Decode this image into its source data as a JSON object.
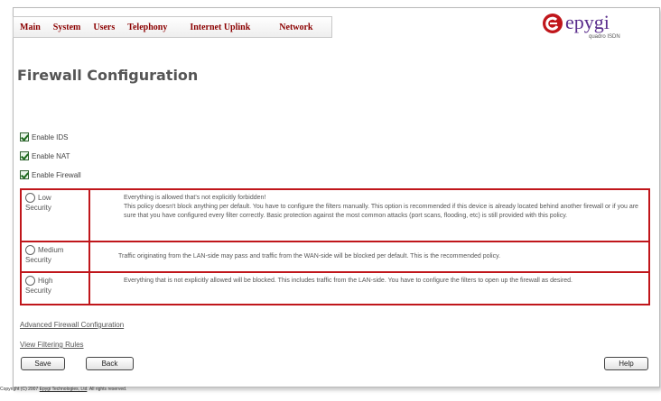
{
  "menu": {
    "items": [
      "Main",
      "System",
      "Users",
      "Telephony",
      "Internet Uplink",
      "Network"
    ]
  },
  "logo": {
    "brand": "epygi",
    "subtitle": "quadro ISDN",
    "colors": {
      "mark": "#c0161b",
      "brand": "#5a2d8c"
    }
  },
  "page": {
    "title": "Firewall Configuration"
  },
  "options": {
    "ids": {
      "label": "Enable IDS",
      "checked": true
    },
    "nat": {
      "label": "Enable NAT",
      "checked": true
    },
    "firewall": {
      "label": "Enable Firewall",
      "checked": true
    }
  },
  "security": {
    "low": {
      "label_line1": "Low",
      "label_line2": "Security",
      "desc_line1": "Everything is allowed that's not explicitly forbidden!",
      "desc_rest": "This policy doesn't block anything per default. You have to configure the filters manually. This option is recommended if this device is already located behind another firewall or if you are sure that you have configured every filter correctly. Basic protection against the most common attacks (port scans, flooding, etc) is still provided with this policy."
    },
    "medium": {
      "label_line1": "Medium",
      "label_line2": "Security",
      "desc": "Traffic originating from the LAN-side may pass and traffic from the WAN-side will be blocked per default. This is the recommended policy."
    },
    "high": {
      "label_line1": "High",
      "label_line2": "Security",
      "desc": "Everything that is not explicitly allowed will be blocked. This includes traffic from the LAN-side. You have to configure the filters to open up the firewall as desired."
    },
    "border_color": "#c0161b"
  },
  "links": {
    "advanced": "Advanced Firewall Configuration",
    "rules": "View Filtering Rules"
  },
  "buttons": {
    "save": "Save",
    "back": "Back",
    "help": "Help"
  },
  "footer": {
    "prefix": "Copyright (C) 2007",
    "company": "Epygi Technologies, Ltd",
    "suffix": ". All rights reserved."
  }
}
